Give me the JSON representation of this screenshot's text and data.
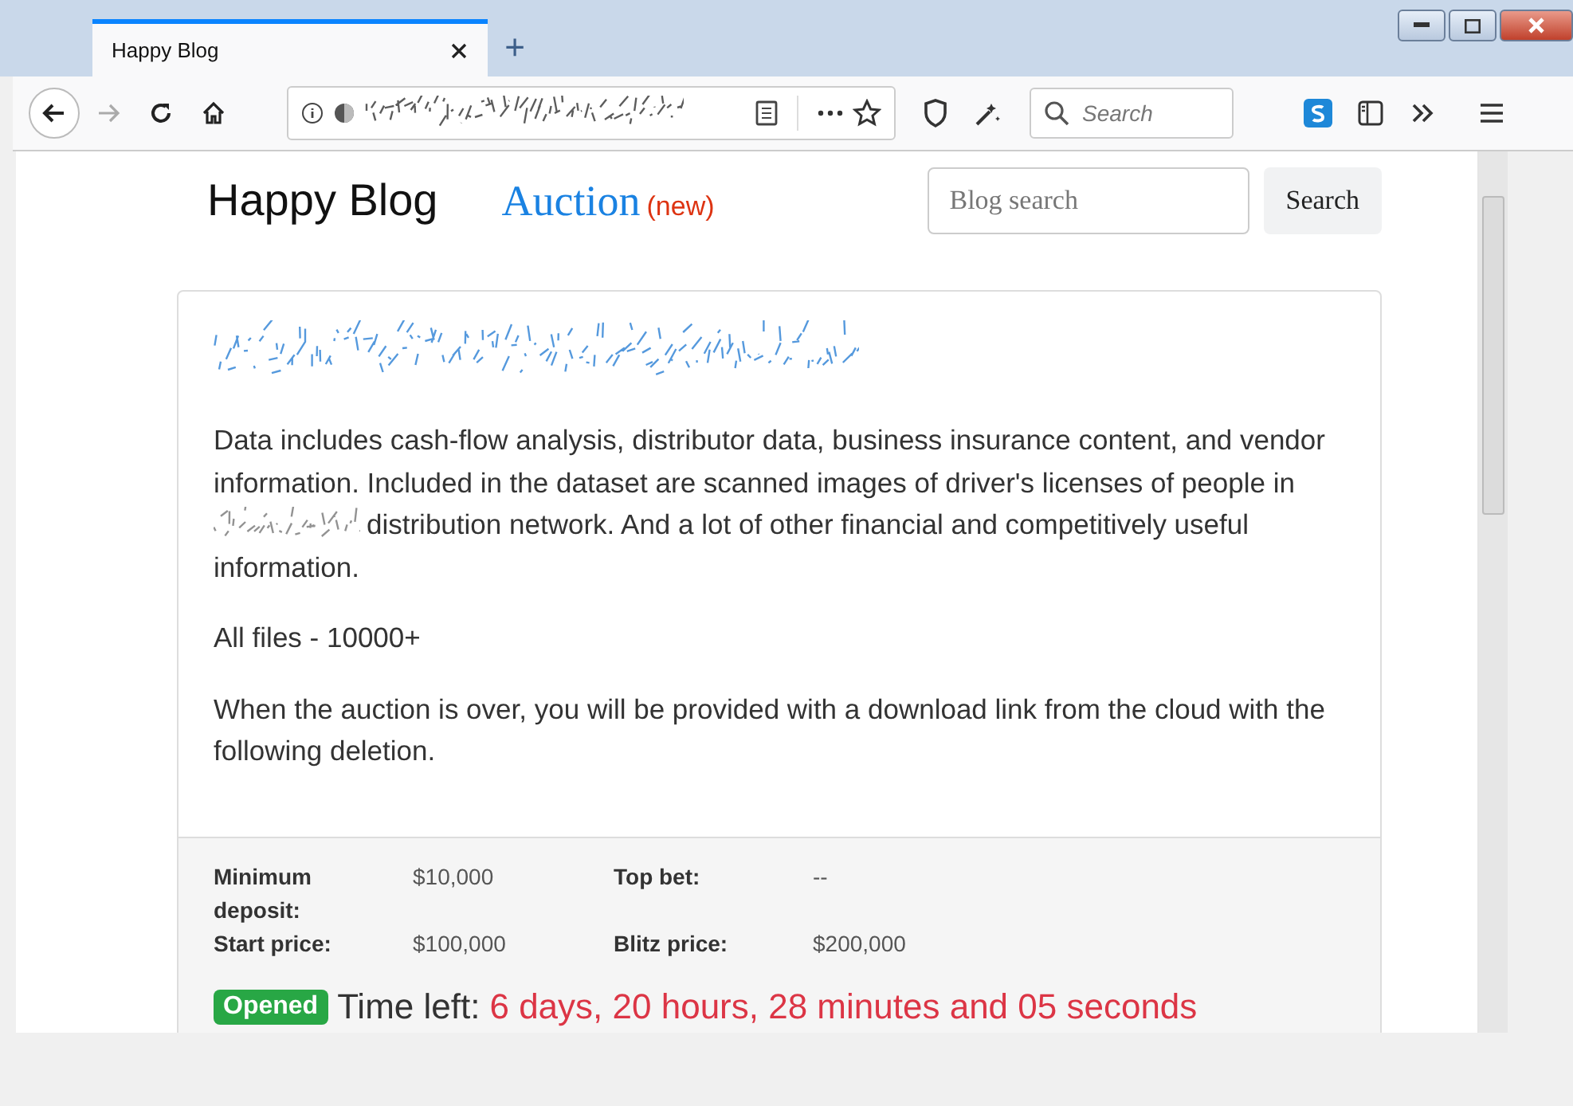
{
  "browser": {
    "tabs": [
      {
        "title": "Happy Blog",
        "selected": true
      }
    ],
    "new_tab": "+",
    "search": {
      "placeholder": "Search"
    }
  },
  "page": {
    "brand": "Happy Blog",
    "nav": [
      {
        "label": "Auction",
        "badge": "(new)"
      }
    ],
    "search": {
      "placeholder": "Blog search",
      "button": "Search"
    },
    "post": {
      "paragraphs": [
        {
          "before": "Data includes cash-flow analysis, distributor data, business insurance content, and vendor information. Included in the dataset are scanned images of driver's licenses of people in",
          "after": "distribution network. And a lot of other financial and competitively useful",
          "tail": "information."
        },
        {
          "before": "All files - 10000+"
        },
        {
          "before": "When the auction is over, you will be provided with a download link from the cloud with the following deletion."
        }
      ],
      "details": [
        {
          "label": "Minimum deposit:",
          "value": "$10,000"
        },
        {
          "label": "Top bet:",
          "value": "--"
        },
        {
          "label": "Start price:",
          "value": "$100,000"
        },
        {
          "label": "Blitz price:",
          "value": "$200,000"
        }
      ],
      "status": "Opened",
      "time_label": "Time left:",
      "countdown": "6 days, 20 hours, 28 minutes and 05 seconds"
    }
  }
}
